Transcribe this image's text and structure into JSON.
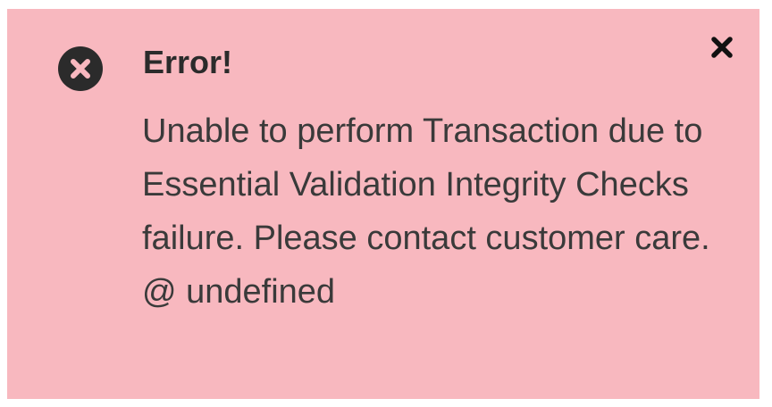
{
  "alert": {
    "type": "error",
    "icon": "circle-x-icon",
    "title": "Error!",
    "message": "Unable to perform Transaction due to Essential Validation Integrity Checks failure. Please contact customer care. @ undefined",
    "close_icon": "close-icon",
    "colors": {
      "background": "#f8b8bf",
      "icon": "#2b2b2b",
      "text": "#3a3a3a"
    }
  }
}
